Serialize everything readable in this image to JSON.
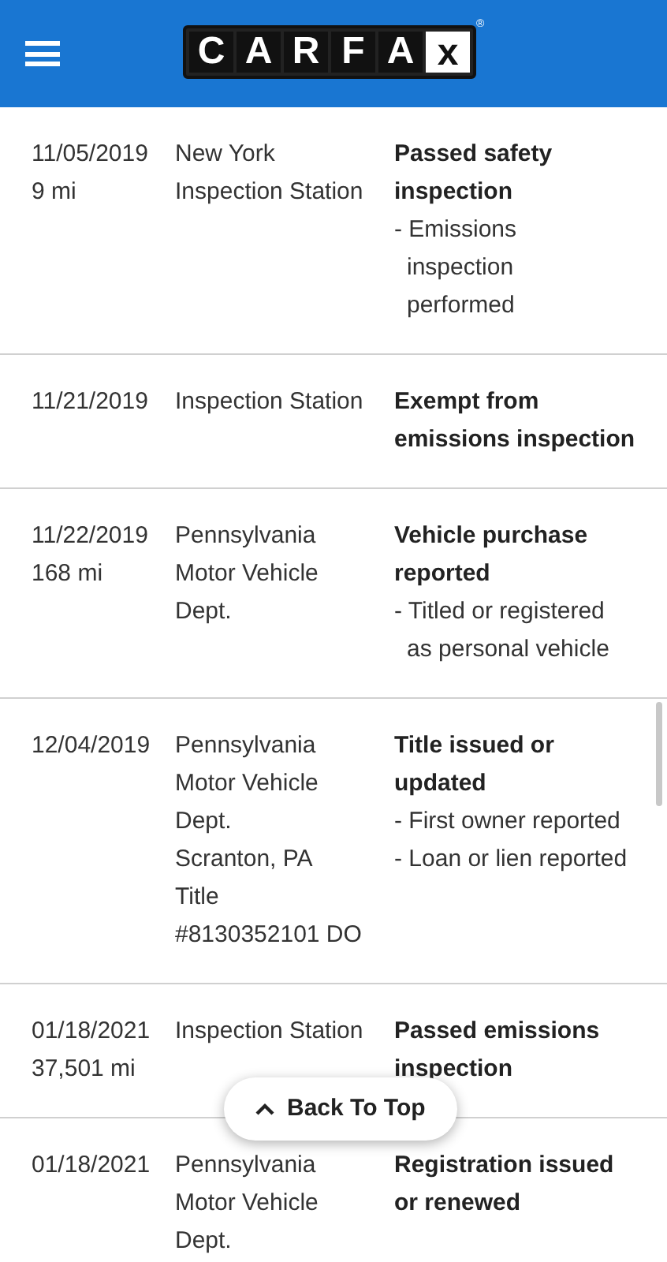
{
  "header": {
    "logo_letters": [
      "C",
      "A",
      "R",
      "F",
      "A",
      "x"
    ],
    "logo_mark": "®"
  },
  "records": [
    {
      "date": "11/05/2019",
      "mileage": "9 mi",
      "source": [
        "New York",
        "Inspection Station"
      ],
      "title": [
        "Passed safety",
        "inspection"
      ],
      "details": [
        [
          "- Emissions",
          "inspection",
          "performed"
        ]
      ]
    },
    {
      "date": "11/21/2019",
      "source": [
        "Inspection Station"
      ],
      "title": [
        "Exempt from",
        "emissions inspection"
      ]
    },
    {
      "date": "11/22/2019",
      "mileage": "168 mi",
      "source": [
        "Pennsylvania",
        "Motor Vehicle",
        "Dept."
      ],
      "title": [
        "Vehicle purchase",
        "reported"
      ],
      "details": [
        [
          "- Titled or registered",
          "as personal vehicle"
        ]
      ]
    },
    {
      "date": "12/04/2019",
      "source": [
        "Pennsylvania",
        "Motor Vehicle",
        "Dept.",
        "Scranton, PA",
        "Title",
        "#8130352101 DO"
      ],
      "title": [
        "Title issued or",
        "updated"
      ],
      "details": [
        [
          "- First owner reported"
        ],
        [
          "- Loan or lien reported"
        ]
      ]
    },
    {
      "date": "01/18/2021",
      "mileage": "37,501 mi",
      "source": [
        "Inspection Station"
      ],
      "title": [
        "Passed emissions",
        "inspection"
      ]
    },
    {
      "date": "01/18/2021",
      "source": [
        "Pennsylvania",
        "Motor Vehicle",
        "Dept."
      ],
      "title": [
        "Registration issued",
        "or renewed"
      ]
    }
  ],
  "back_to_top": {
    "label": "Back To Top"
  }
}
